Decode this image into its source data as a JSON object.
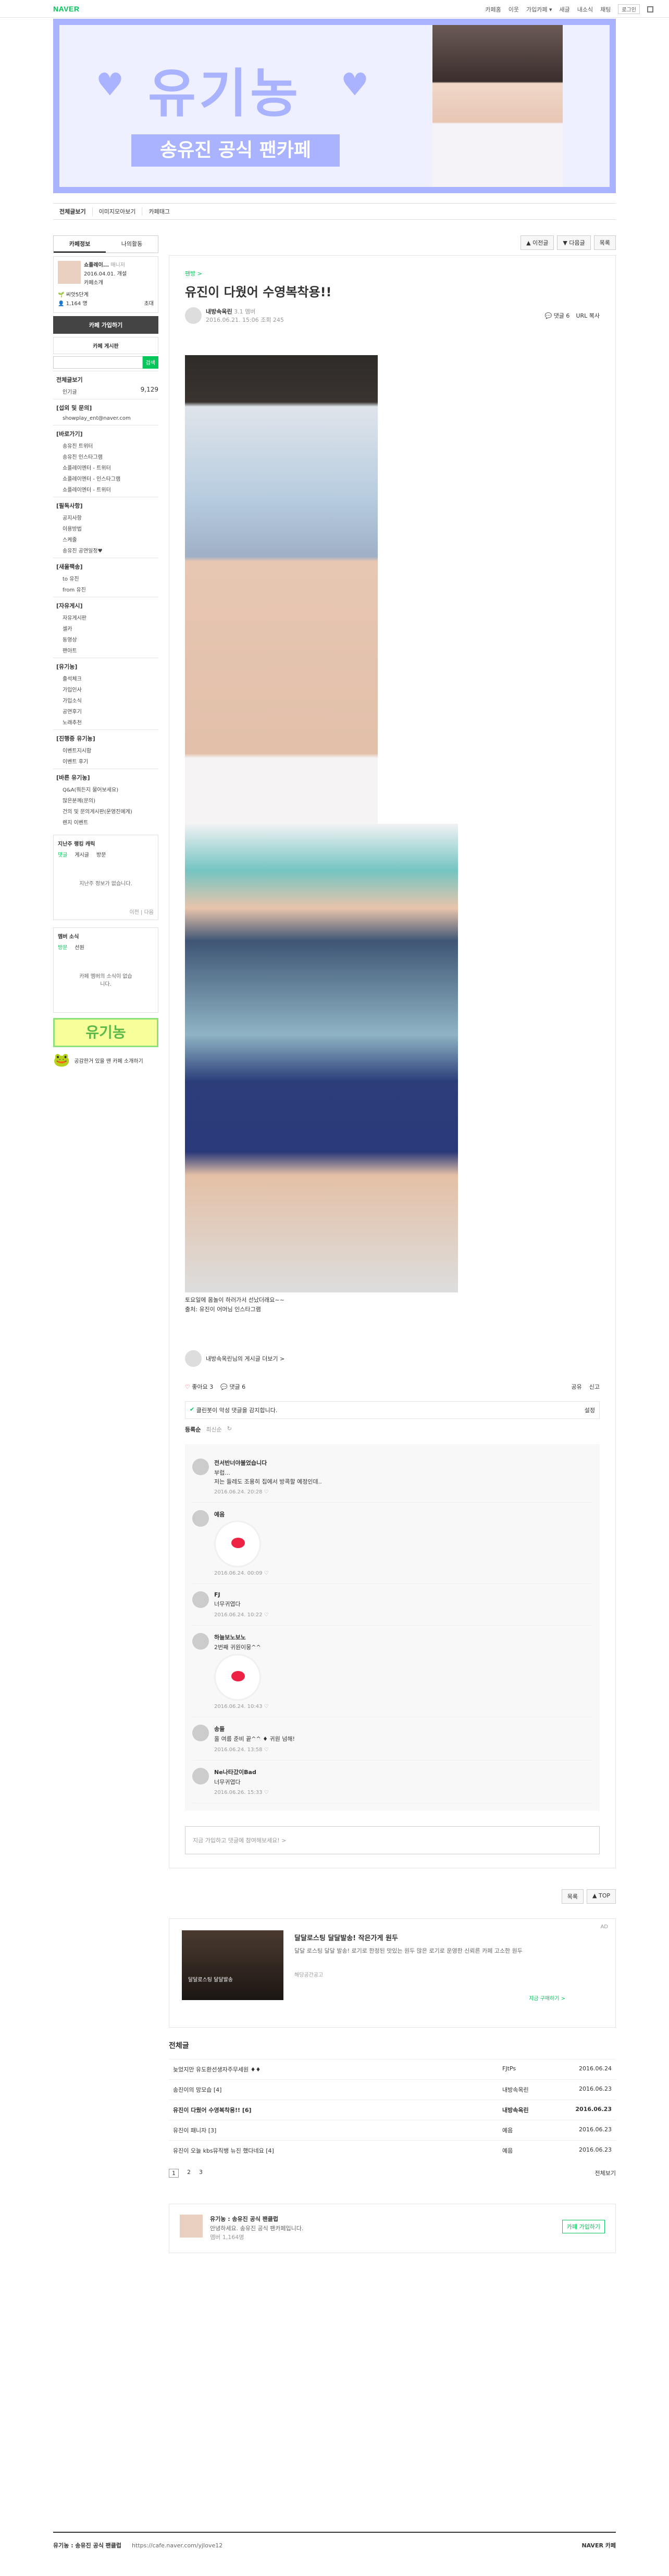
{
  "top": {
    "logo": "NAVER",
    "links": [
      "카페홈",
      "이웃",
      "가입카페 ▾",
      "새글",
      "내소식",
      "채팅"
    ],
    "login": "로그인"
  },
  "banner": {
    "title": "유기농",
    "subtitle": "송유진 공식 팬카페"
  },
  "nav": [
    "전체글보기",
    "이미지모아보기",
    "카페태그"
  ],
  "sidebar": {
    "tabs": [
      "카페정보",
      "나의활동"
    ],
    "manager": "쇼플레이...",
    "manager_tag": "매니저",
    "since": "2016.04.01. 개설",
    "intro": "카페소개",
    "level": "씨앗5단계",
    "members": "1,164 명",
    "invite": "초대",
    "join": "카페 가입하기",
    "search": "카페 게시판",
    "search_btn": "검색",
    "menus": [
      {
        "head": "전체글보기",
        "count": "9,129",
        "items": [
          "인기글"
        ]
      },
      {
        "head": "[섭외 및 문의]",
        "items": [
          "showplay_ent@naver.com"
        ]
      },
      {
        "head": "[바로가기]",
        "items": [
          "송유진 트위터",
          "송유진 인스타그램",
          "쇼플레이엔터 - 트위터",
          "쇼플레이엔터 - 인스타그램",
          "쇼플레이엔터 - 트위터"
        ]
      },
      {
        "head": "[필독사항]",
        "items": [
          "공지사항",
          "이용방법",
          "스케줄",
          "송유진 공연일정♥"
        ]
      },
      {
        "head": "[새울팩송]",
        "items": [
          "to 유진",
          "from 유진"
        ]
      },
      {
        "head": "[자유게시]",
        "items": [
          "자유게시판",
          "셀카",
          "동영상",
          "팬아트"
        ]
      },
      {
        "head": "[유기농]",
        "items": [
          "출석체크",
          "가입인사",
          "가입소식",
          "공연후기",
          "노래추천"
        ]
      },
      {
        "head": "[진행중 유기농]",
        "items": [
          "이벤트지시함",
          "이벤트 후기"
        ]
      },
      {
        "head": "[바른 유기농]",
        "items": [
          "Q&A(뭐든지 물어보세요)",
          "많은분께(문의)",
          "건의 및 문의게시판(운영진에게)"
        ]
      },
      {
        "head": "",
        "items": [
          "렌지 이벤트"
        ]
      }
    ],
    "recent_title": "지난주 랭킹 캐릭",
    "recent_tabs": [
      "댓글",
      "게시글",
      "방문"
    ],
    "recent_empty": "지난주 정보가 없습니다.",
    "recent_nav": [
      "이전",
      "다음"
    ],
    "news_title": "멤버 소식",
    "news_tabs": [
      "방문",
      "선원"
    ],
    "news_empty": "카페 멤버의 소식이 없습니다.",
    "logo": "유기농",
    "promo": "공감한거 있을 땐 카페 소개하기"
  },
  "content": {
    "top_btns": [
      "▲ 이전글",
      "▼ 다음글",
      "목록"
    ],
    "category": "팬방 >",
    "title": "유진이 다웠어 수영복착용!!",
    "author": "내방속옥린",
    "author_level": "3.1 멤버",
    "date": "2016.06.21. 15:06",
    "views": "조회 245",
    "comments": "댓글 6",
    "url": "URL 복사",
    "caption1": "토요일에 몸놀이 하러가서 선났더래요~~",
    "caption2": "출처: 유진이 어머님 인스타그램",
    "sign": "내방속옥린님의 게시글 더보기 >",
    "likes": "좋아요 3",
    "cmt_count": "댓글 6",
    "share": "공유",
    "report": "신고",
    "bot_text": "클린봇이 악성 댓글을 감지합니다.",
    "bot_set": "설정",
    "sort": [
      "등록순",
      "최신순"
    ],
    "comment_list": [
      {
        "name": "전서반너야불었습니다",
        "text": "부럽...\n저는 들레도 조용히 집에서 방콕할 예정인데..",
        "date": "2016.06.24. 20:28"
      },
      {
        "name": "예음",
        "text": "",
        "date": "2016.06.24. 00:09"
      },
      {
        "name": "FJ",
        "text": "너무귀엽다",
        "date": "2016.06.24. 10:22"
      },
      {
        "name": "하늘보노보노",
        "text": "2번째 귀원이뭉^^",
        "date": "2016.06.24. 10:43"
      },
      {
        "name": "송들",
        "text": "올 여름 준비 끝^^ ♦ 귀원 넘해!",
        "date": "2016.06.24. 13:58"
      },
      {
        "name": "Ne나타갔이Bad",
        "text": "너무귀엽다",
        "date": "2016.06.26. 15:33"
      }
    ],
    "input": "지금 가입하고 댓글에 참여해보세요! >",
    "bottom_btns": [
      "목록",
      "▲ TOP"
    ],
    "ad_label": "AD",
    "ad_title": "달달로스팅 달달발송! 작은가게 원두",
    "ad_desc": "달달 로스팅 달달 발송! 로기로 한정된 맛있는 원두 많은 로기로 운영한 신뢰른 카페 고소한 원두",
    "ad_sub": "해당공간공고",
    "ad_link": "지금 구매하기 >",
    "ad_img": "달달로스팅 달달발송",
    "list_title": "전체글",
    "rows": [
      {
        "t": "늦었지만 유도환선생자주무세원 ♦♦",
        "w": "FJtPs",
        "d": "2016.06.24"
      },
      {
        "t": "송진이의 망모습 [4]",
        "w": "내방속옥린",
        "d": "2016.06.23"
      },
      {
        "t": "유진이 다웠어 수영복착용!! [6]",
        "w": "내방속옥린",
        "d": "2016.06.23"
      },
      {
        "t": "유진이 패니자 [3]",
        "w": "예음",
        "d": "2016.06.23"
      },
      {
        "t": "유진이 오늘 kbs뮤직뱅 뉴진 했다네요 [4]",
        "w": "예음",
        "d": "2016.06.23"
      }
    ],
    "pages": [
      "1",
      "2",
      "3"
    ],
    "all": "전체보기",
    "cafe_name": "유기농 : 송유진 공식 팬클럽",
    "cafe_desc": "안녕하세요. 송유진 공식 팬카페입니다.",
    "cafe_members": "멤버 1,164명",
    "cafe_join": "카페 가입하기"
  },
  "footer": {
    "name": "유기농 : 송유진 공식 팬클럽",
    "url": "https://cafe.naver.com/yjlove12",
    "brand": "NAVER 카페"
  }
}
